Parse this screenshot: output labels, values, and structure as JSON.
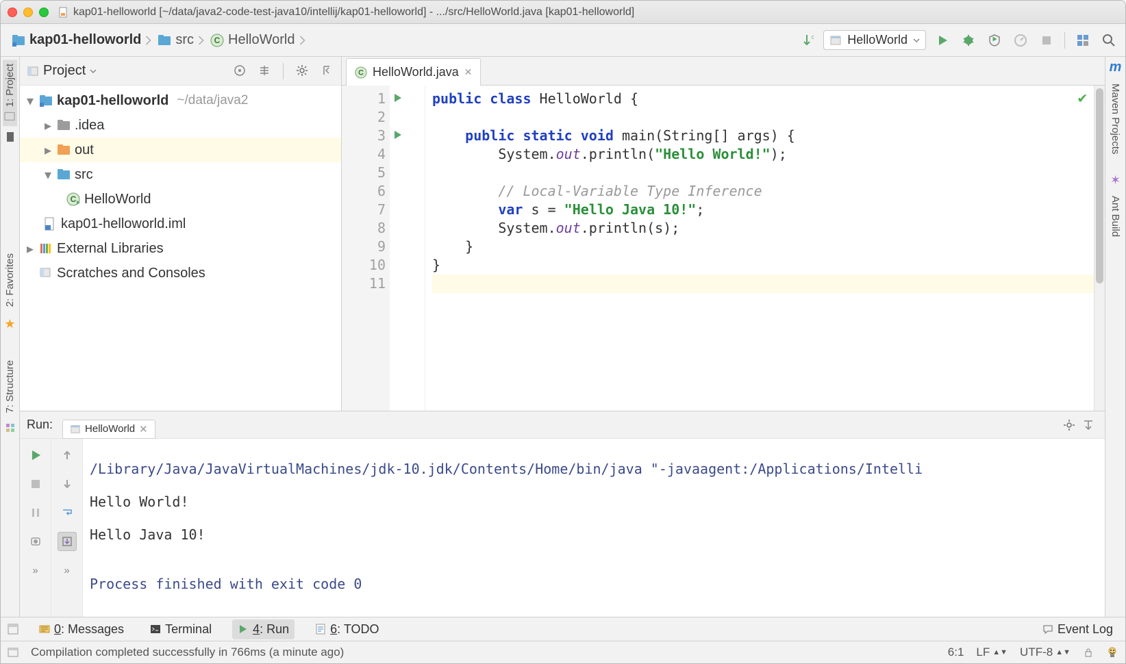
{
  "titlebar": {
    "text": "kap01-helloworld [~/data/java2-code-test-java10/intellij/kap01-helloworld] - .../src/HelloWorld.java [kap01-helloworld]"
  },
  "breadcrumbs": {
    "items": [
      {
        "label": "kap01-helloworld",
        "bold": true,
        "icon": "module"
      },
      {
        "label": "src",
        "bold": false,
        "icon": "folder"
      },
      {
        "label": "HelloWorld",
        "bold": false,
        "icon": "class"
      }
    ]
  },
  "run_config": {
    "label": "HelloWorld"
  },
  "left_stripe": {
    "project": "1: Project",
    "favorites": "2: Favorites",
    "structure": "7: Structure"
  },
  "right_stripe": {
    "maven": "Maven Projects",
    "ant": "Ant Build"
  },
  "project_panel": {
    "title": "Project",
    "tree": {
      "root": {
        "name": "kap01-helloworld",
        "path": "~/data/java2"
      },
      "idea": {
        "name": ".idea"
      },
      "out": {
        "name": "out"
      },
      "src": {
        "name": "src"
      },
      "class": {
        "name": "HelloWorld"
      },
      "iml": {
        "name": "kap01-helloworld.iml"
      },
      "extlib": {
        "name": "External Libraries"
      },
      "scratches": {
        "name": "Scratches and Consoles"
      }
    }
  },
  "editor": {
    "tab": "HelloWorld.java",
    "lines": {
      "n1": "1",
      "n2": "2",
      "n3": "3",
      "n4": "4",
      "n5": "5",
      "n6": "6",
      "n7": "7",
      "n8": "8",
      "n9": "9",
      "n10": "10",
      "n11": "11"
    },
    "code": {
      "l1_kw1": "public",
      "l1_kw2": "class",
      "l1_rest": " HelloWorld {",
      "l2": "",
      "l3_pre": "    ",
      "l3_kw1": "public",
      "l3_kw2": "static",
      "l3_kw3": "void",
      "l3_rest": " main(String[] args) {",
      "l4_pre": "        System.",
      "l4_field": "out",
      "l4_mid": ".println(",
      "l4_str": "\"Hello World!\"",
      "l4_end": ");",
      "l5": "",
      "l6_pre": "        ",
      "l6_comment": "// Local-Variable Type Inference",
      "l7_pre": "        ",
      "l7_kw": "var",
      "l7_mid": " s = ",
      "l7_str": "\"Hello Java 10!\"",
      "l7_end": ";",
      "l8_pre": "        System.",
      "l8_field": "out",
      "l8_end": ".println(s);",
      "l9": "    }",
      "l10": "}",
      "l11": ""
    }
  },
  "run_panel": {
    "title": "Run:",
    "tab": "HelloWorld",
    "console": {
      "cmd": "/Library/Java/JavaVirtualMachines/jdk-10.jdk/Contents/Home/bin/java \"-javaagent:/Applications/Intelli",
      "out1": "Hello World!",
      "out2": "Hello Java 10!",
      "blank": "",
      "exit": "Process finished with exit code 0"
    }
  },
  "toolstrip": {
    "messages_u": "0",
    "messages": ": Messages",
    "terminal": "Terminal",
    "run_u": "4",
    "run": ": Run",
    "todo_u": "6",
    "todo": ": TODO",
    "eventlog": "Event Log"
  },
  "status": {
    "msg": "Compilation completed successfully in 766ms (a minute ago)",
    "pos": "6:1",
    "le": "LF",
    "enc": "UTF-8"
  }
}
